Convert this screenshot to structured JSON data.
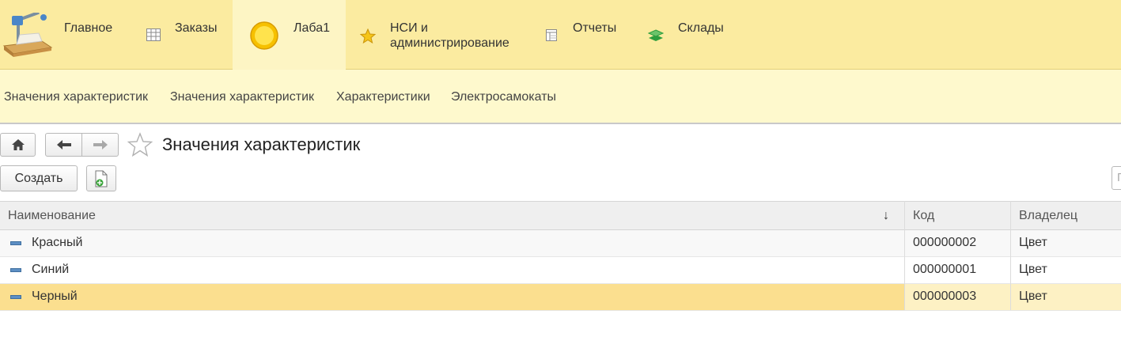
{
  "sections": {
    "main": "Главное",
    "orders": "Заказы",
    "lab": "Лаба1",
    "nsi_line1": "НСИ и",
    "nsi_line2": "администрирование",
    "reports": "Отчеты",
    "warehouses": "Склады"
  },
  "subnav": [
    "Значения характеристик",
    "Значения характеристик",
    "Характеристики",
    "Электросамокаты"
  ],
  "page_title": "Значения характеристик",
  "toolbar": {
    "create_label": "Создать"
  },
  "table": {
    "columns": [
      "Наименование",
      "Код",
      "Владелец"
    ],
    "sort_indicator": "↓",
    "rows": [
      {
        "name": "Красный",
        "code": "000000002",
        "owner": "Цвет"
      },
      {
        "name": "Синий",
        "code": "000000001",
        "owner": "Цвет"
      },
      {
        "name": "Черный",
        "code": "000000003",
        "owner": "Цвет"
      }
    ]
  },
  "search_placeholder": "П",
  "colors": {
    "section_bar": "#fbeba0",
    "subnav": "#fef9cd",
    "selected_row": "#fbdf8f"
  },
  "icons": [
    "desk-lamp-icon",
    "table-icon",
    "yellow-circle-icon",
    "star-icon",
    "report-icon",
    "layers-icon",
    "home-icon",
    "back-arrow-icon",
    "forward-arrow-icon",
    "favorite-star-icon",
    "add-document-icon",
    "row-marker-icon"
  ]
}
